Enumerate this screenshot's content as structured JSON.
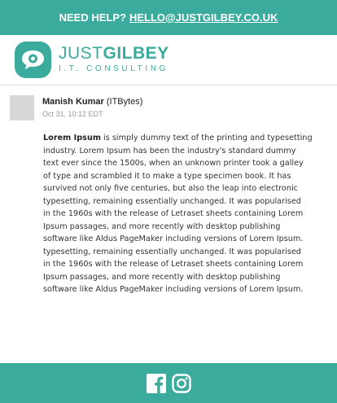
{
  "header": {
    "help_label": "NEED HELP?",
    "email": "HELLO@JUSTGILBEY.CO.UK"
  },
  "logo": {
    "name_part1": "JUST",
    "name_part2": "GILBEY",
    "tagline": "I.T. CONSULTING",
    "icon": "speech-bubble-icon"
  },
  "message": {
    "author": "Manish Kumar",
    "organization": "(ITBytes)",
    "timestamp": "Oct 31, 10:12 EDT",
    "lead": "Lorem Ipsum",
    "body": " is simply dummy text of the printing and typesetting\nindustry. Lorem Ipsum has been the industry's standard dummy\ntext ever since the 1500s, when an unknown printer took a galley\nof type and scrambled it to make a type specimen book. It has\nsurvived not only five centuries, but also the leap into electronic\ntypesetting, remaining essentially unchanged. It was popularised\nin the 1960s with the release of Letraset sheets containing Lorem\nIpsum passages, and more recently with desktop publishing\nsoftware like Aldus PageMaker including versions of Lorem Ipsum.\ntypesetting, remaining essentially unchanged. It was popularised\nin the 1960s with the release of Letraset sheets containing Lorem\nIpsum passages, and more recently with desktop publishing\nsoftware like Aldus PageMaker including versions of Lorem Ipsum."
  },
  "footer": {
    "icons": [
      "facebook-icon",
      "instagram-icon"
    ]
  },
  "colors": {
    "brand": "#3bab9d",
    "divider": "#d9d9d9",
    "avatar": "#d8d8d8"
  }
}
